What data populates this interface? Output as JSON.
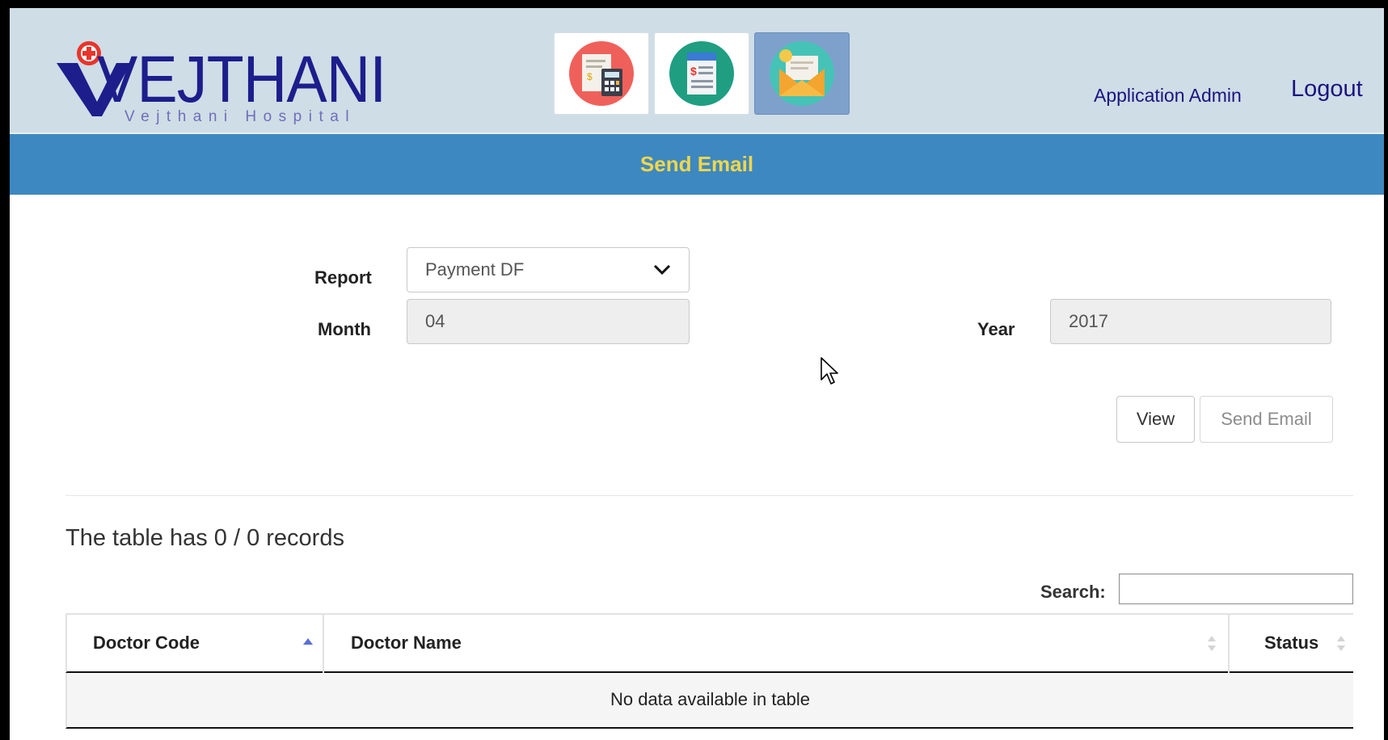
{
  "header": {
    "logo_text": "VEJTHANI",
    "logo_subtext": "Vejthani Hospital",
    "apps": [
      {
        "icon": "report-calculator-icon"
      },
      {
        "icon": "invoice-icon"
      },
      {
        "icon": "email-icon",
        "active": true
      }
    ],
    "user_link": "Application Admin",
    "logout_label": "Logout"
  },
  "page_title": "Send Email",
  "form": {
    "report_label": "Report",
    "report_value": "Payment DF",
    "month_label": "Month",
    "month_value": "04",
    "year_label": "Year",
    "year_value": "2017",
    "view_label": "View",
    "send_label": "Send Email"
  },
  "table": {
    "records_text": "The table has 0 / 0 records",
    "search_label": "Search:",
    "search_value": "",
    "columns": [
      "Doctor Code",
      "Doctor Name",
      "Status"
    ],
    "empty_message": "No data available in table"
  },
  "colors": {
    "header_bg": "#cfdde6",
    "title_bar": "#3d88c0",
    "title_text": "#f2d64b",
    "link": "#1b1480"
  }
}
